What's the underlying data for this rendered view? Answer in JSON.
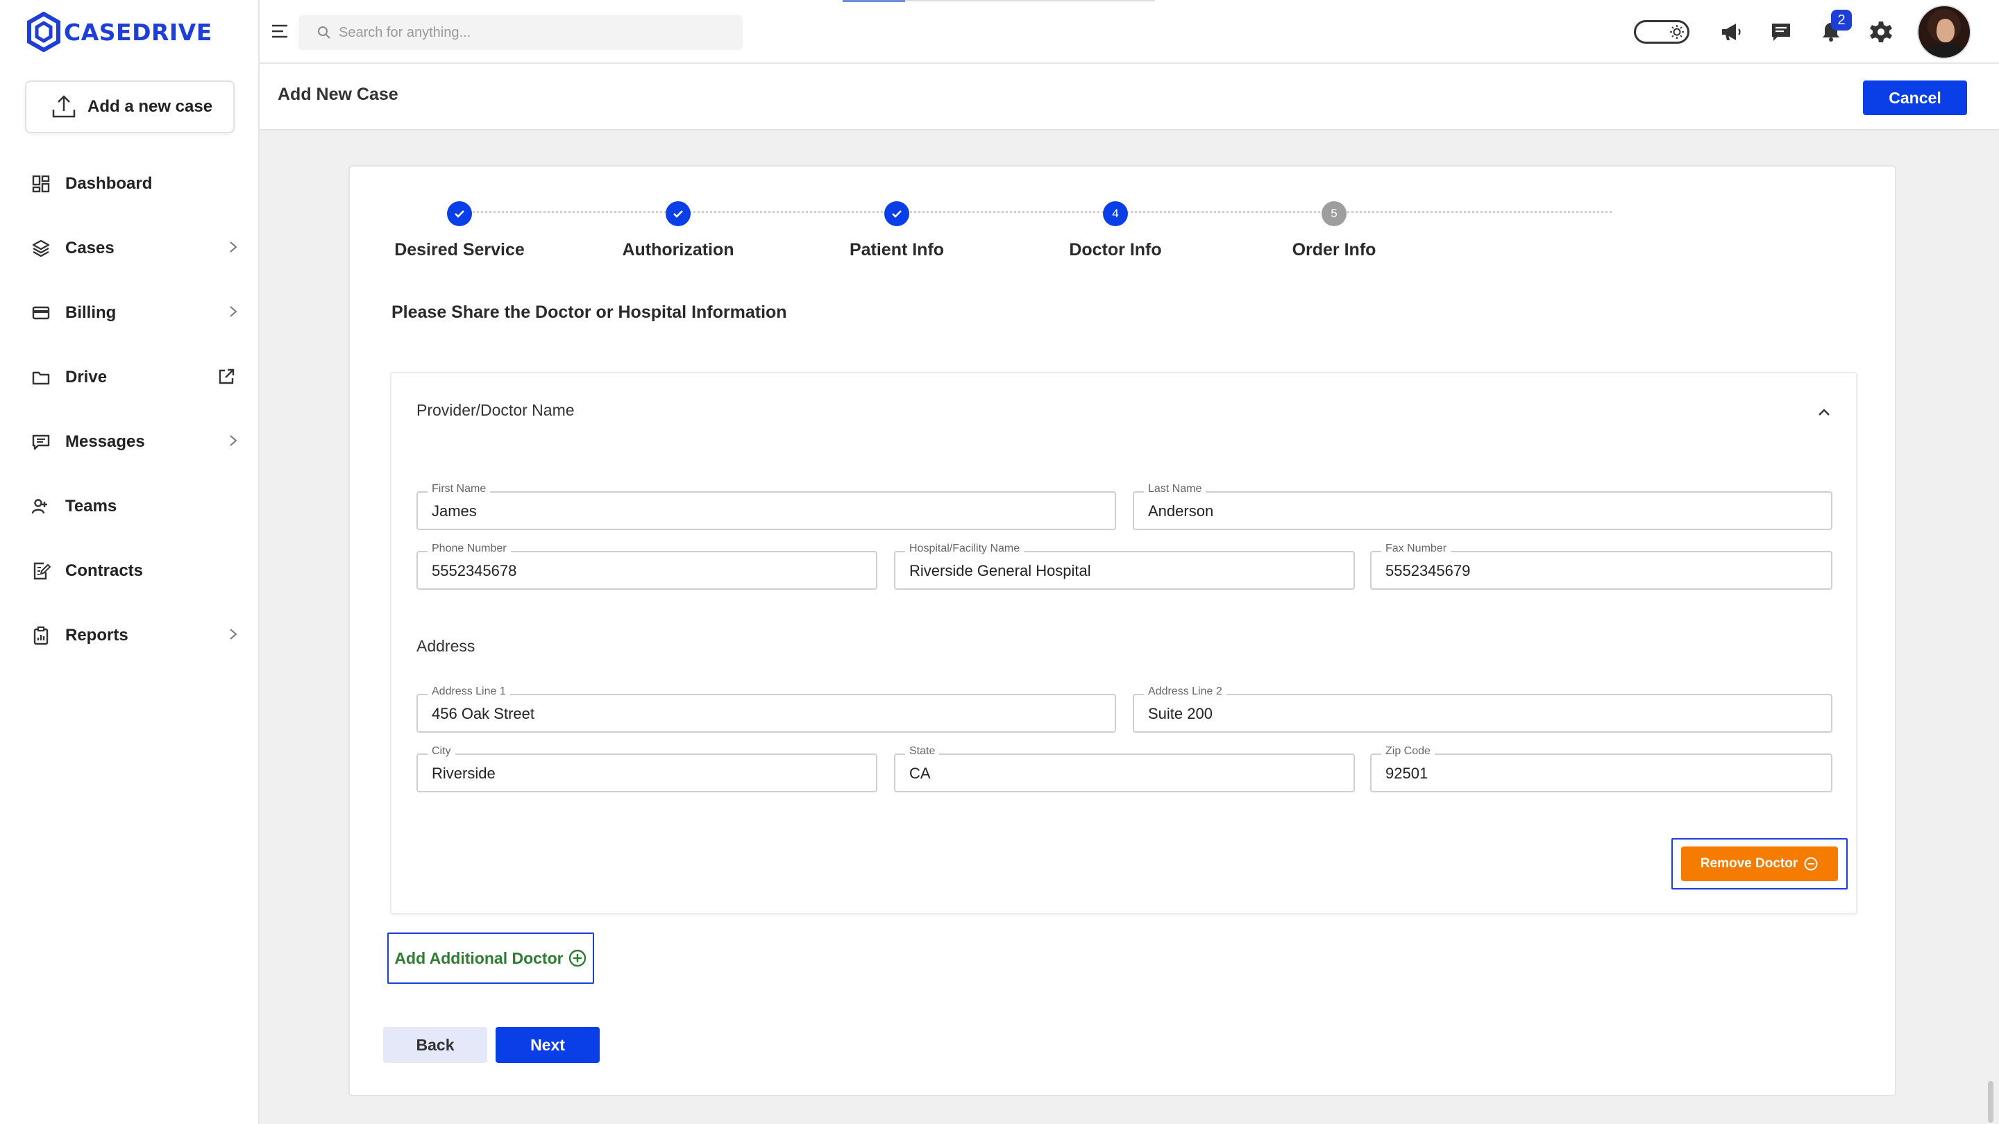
{
  "app": {
    "brand": "CASEDRIVE",
    "brand_color": "#1d3fd6",
    "accent_color": "#0a3fe8",
    "warning_color": "#f57c00",
    "success_color": "#2e7d32"
  },
  "sidebar": {
    "add_case_label": "Add a new case",
    "items": [
      {
        "label": "Dashboard",
        "icon": "dashboard-icon",
        "has_chevron": false
      },
      {
        "label": "Cases",
        "icon": "layers-icon",
        "has_chevron": true
      },
      {
        "label": "Billing",
        "icon": "credit-card-icon",
        "has_chevron": true
      },
      {
        "label": "Drive",
        "icon": "folder-icon",
        "has_external": true
      },
      {
        "label": "Messages",
        "icon": "message-icon",
        "has_chevron": true
      },
      {
        "label": "Teams",
        "icon": "team-icon",
        "has_chevron": false
      },
      {
        "label": "Contracts",
        "icon": "contract-icon",
        "has_chevron": false
      },
      {
        "label": "Reports",
        "icon": "report-icon",
        "has_chevron": true
      }
    ]
  },
  "topbar": {
    "search_placeholder": "Search for anything...",
    "notification_count": "2"
  },
  "header": {
    "title": "Add New Case",
    "cancel_label": "Cancel"
  },
  "stepper": {
    "steps": [
      {
        "label": "Desired Service",
        "state": "done",
        "number": "1"
      },
      {
        "label": "Authorization",
        "state": "done",
        "number": "2"
      },
      {
        "label": "Patient Info",
        "state": "done",
        "number": "3"
      },
      {
        "label": "Doctor Info",
        "state": "current",
        "number": "4"
      },
      {
        "label": "Order Info",
        "state": "pending",
        "number": "5"
      }
    ]
  },
  "form": {
    "section_title": "Please Share the Doctor or Hospital Information",
    "panel_title": "Provider/Doctor Name",
    "fields": {
      "first_name": {
        "label": "First Name",
        "value": "James"
      },
      "last_name": {
        "label": "Last Name",
        "value": "Anderson"
      },
      "phone": {
        "label": "Phone Number",
        "value": "5552345678"
      },
      "hospital": {
        "label": "Hospital/Facility Name",
        "value": "Riverside General Hospital"
      },
      "fax": {
        "label": "Fax Number",
        "value": "5552345679"
      },
      "address1": {
        "label": "Address Line 1",
        "value": "456 Oak Street"
      },
      "address2": {
        "label": "Address Line 2",
        "value": "Suite 200"
      },
      "city": {
        "label": "City",
        "value": "Riverside"
      },
      "state": {
        "label": "State",
        "value": "CA"
      },
      "zip": {
        "label": "Zip Code",
        "value": "92501"
      }
    },
    "address_label": "Address",
    "remove_label": "Remove Doctor",
    "add_label": "Add Additional Doctor",
    "back_label": "Back",
    "next_label": "Next"
  }
}
